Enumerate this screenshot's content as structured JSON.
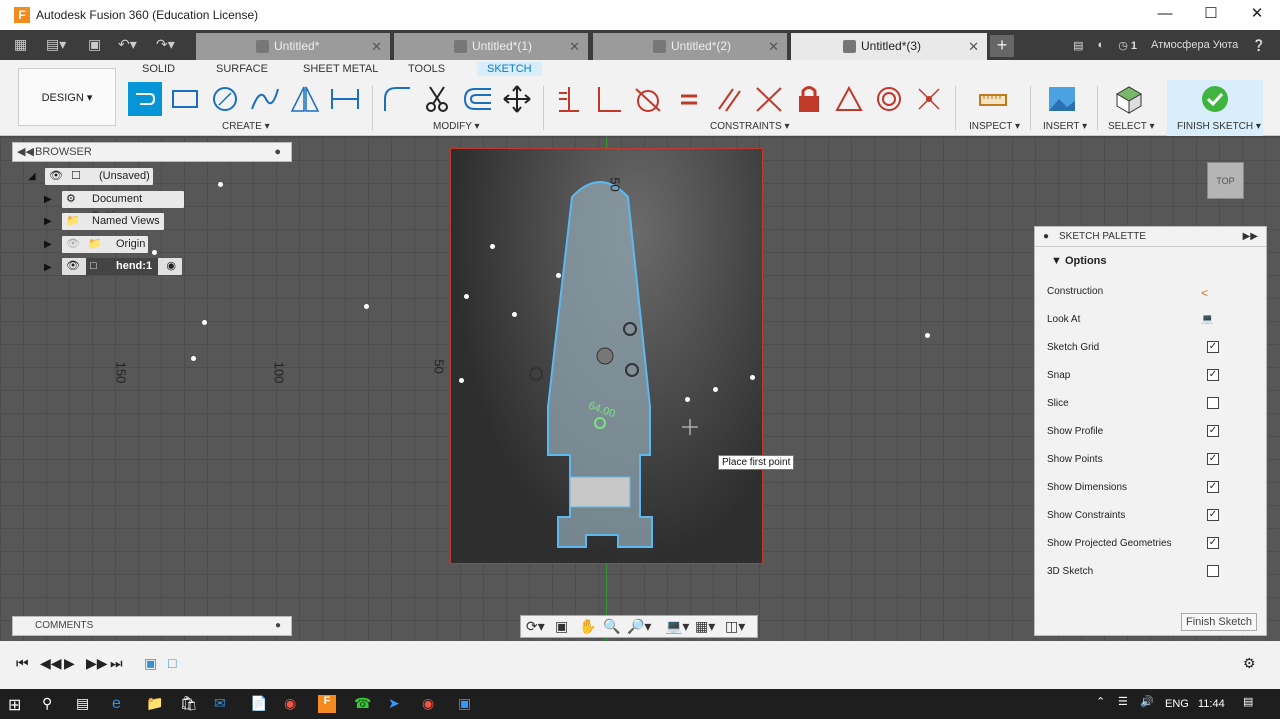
{
  "app": {
    "title": "Autodesk Fusion 360 (Education License)",
    "logo": "F"
  },
  "tabs": [
    {
      "label": "Untitled*",
      "active": false
    },
    {
      "label": "Untitled*(1)",
      "active": false
    },
    {
      "label": "Untitled*(2)",
      "active": false
    },
    {
      "label": "Untitled*(3)",
      "active": true
    }
  ],
  "tabbar_right": {
    "jobs": "1",
    "user": "Атмосфера Уюта"
  },
  "ribbon": {
    "workspace": "DESIGN",
    "tabs": [
      "SOLID",
      "SURFACE",
      "SHEET METAL",
      "TOOLS",
      "SKETCH"
    ],
    "groups": [
      "CREATE",
      "MODIFY",
      "CONSTRAINTS",
      "INSPECT",
      "INSERT",
      "SELECT",
      "FINISH SKETCH"
    ]
  },
  "browser": {
    "title": "BROWSER",
    "items": [
      {
        "label": "(Unsaved)"
      },
      {
        "label": "Document Settings"
      },
      {
        "label": "Named Views"
      },
      {
        "label": "Origin"
      },
      {
        "label": "hend:1"
      }
    ]
  },
  "comments": {
    "title": "COMMENTS"
  },
  "viewport": {
    "tooltip": "Place first point",
    "axis_labels": [
      "150",
      "100",
      "50",
      "50"
    ],
    "dimension": "64.00",
    "viewcube": "TOP"
  },
  "palette": {
    "title": "SKETCH PALETTE",
    "section": "Options",
    "rows": [
      {
        "label": "Construction",
        "type": "icon"
      },
      {
        "label": "Look At",
        "type": "icon"
      },
      {
        "label": "Sketch Grid",
        "checked": true
      },
      {
        "label": "Snap",
        "checked": true
      },
      {
        "label": "Slice",
        "checked": false
      },
      {
        "label": "Show Profile",
        "checked": true
      },
      {
        "label": "Show Points",
        "checked": true
      },
      {
        "label": "Show Dimensions",
        "checked": true
      },
      {
        "label": "Show Constraints",
        "checked": true
      },
      {
        "label": "Show Projected Geometries",
        "checked": true
      },
      {
        "label": "3D Sketch",
        "checked": false
      }
    ],
    "finish_button": "Finish Sketch"
  },
  "taskbar": {
    "lang": "ENG",
    "time": "11:44"
  }
}
